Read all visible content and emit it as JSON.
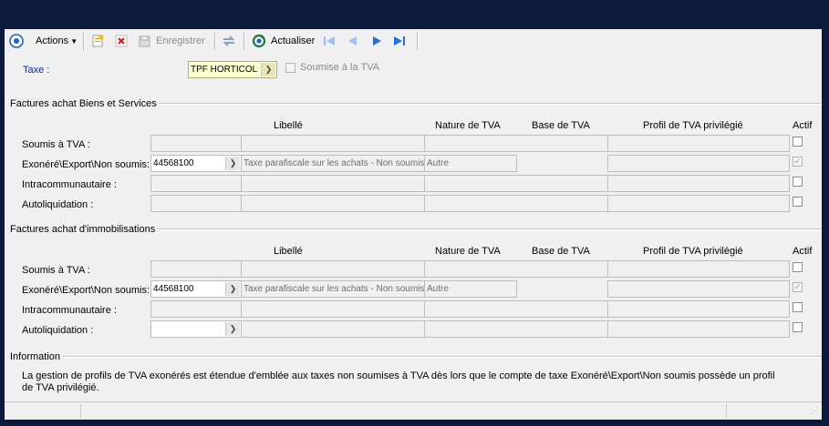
{
  "toolbar": {
    "actions_label": "Actions",
    "save_label": "Enregistrer",
    "refresh_label": "Actualiser"
  },
  "tax": {
    "label": "Taxe :",
    "value": "TPF HORTICOL",
    "subject_checkbox_label": "Soumise à la TVA"
  },
  "section_services": {
    "title": "Factures achat Biens et Services",
    "columns": [
      "Libellé",
      "Nature de TVA",
      "Base de TVA",
      "Profil de TVA privilégié",
      "Actif"
    ],
    "rows": [
      {
        "label": "Soumis à TVA :",
        "account": "",
        "libelle": "",
        "nature": "",
        "base": "",
        "profil": "",
        "actif": false
      },
      {
        "label": "Exonéré\\Export\\Non soumis:",
        "account": "44568100",
        "libelle": "Taxe parafiscale sur les achats - Non soumis",
        "nature": "Autre",
        "base": "",
        "profil": "",
        "actif": true
      },
      {
        "label": "Intracommunautaire :",
        "account": "",
        "libelle": "",
        "nature": "",
        "base": "",
        "profil": "",
        "actif": false
      },
      {
        "label": "Autoliquidation :",
        "account": "",
        "libelle": "",
        "nature": "",
        "base": "",
        "profil": "",
        "actif": false
      }
    ]
  },
  "section_immob": {
    "title": "Factures achat d'immobilisations",
    "columns": [
      "Libellé",
      "Nature de TVA",
      "Base de TVA",
      "Profil de TVA privilégié",
      "Actif"
    ],
    "rows": [
      {
        "label": "Soumis à TVA :",
        "account": "",
        "libelle": "",
        "nature": "",
        "base": "",
        "profil": "",
        "actif": false
      },
      {
        "label": "Exonéré\\Export\\Non soumis:",
        "account": "44568100",
        "libelle": "Taxe parafiscale sur les achats - Non soumis",
        "nature": "Autre",
        "base": "",
        "profil": "",
        "actif": true
      },
      {
        "label": "Intracommunautaire :",
        "account": "",
        "libelle": "",
        "nature": "",
        "base": "",
        "profil": "",
        "actif": false
      },
      {
        "label": "Autoliquidation :",
        "account": "",
        "libelle": "",
        "nature": "",
        "base": "",
        "profil": "",
        "actif": false
      }
    ]
  },
  "information": {
    "title": "Information",
    "line1": "La gestion de profils de TVA exonérés est étendue d'emblée aux taxes non soumises à TVA dès lors que le compte de taxe Exonéré\\Export\\Non soumis possède un profil",
    "line2": "de TVA privilégié."
  },
  "colors": {
    "window_bg": "#f0f0f0",
    "desktop_bg": "#0b1a3c",
    "label_blue": "#0a2a9a",
    "combo_highlight": "#ffffcc"
  }
}
